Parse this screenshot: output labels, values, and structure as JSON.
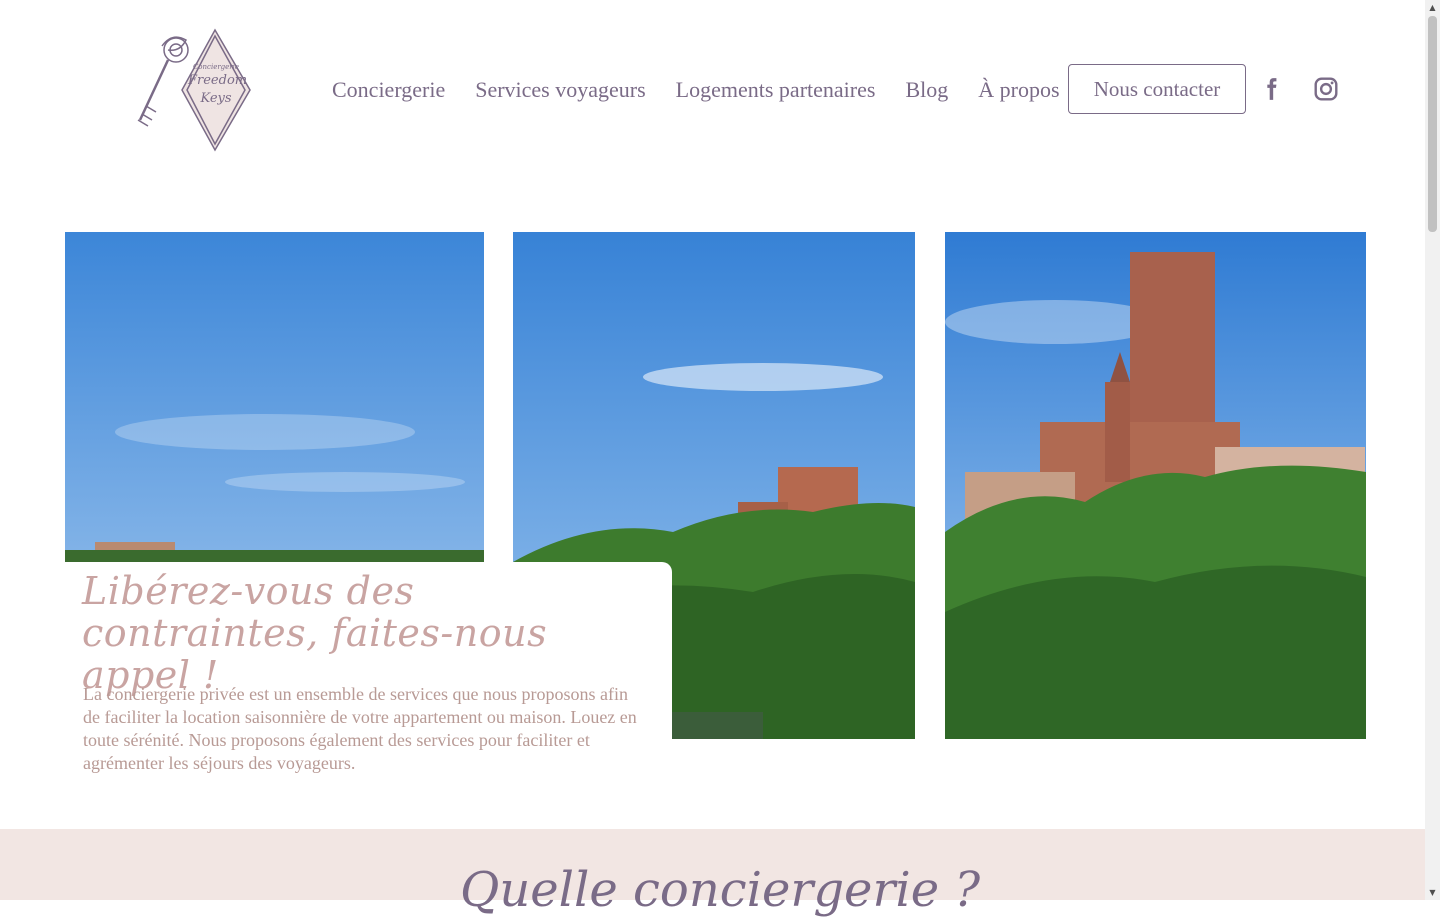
{
  "header": {
    "logo_text_top": "Conciergerie",
    "logo_text_line1": "Freedom",
    "logo_text_line2": "Keys",
    "nav": [
      {
        "label": "Conciergerie"
      },
      {
        "label": "Services voyageurs"
      },
      {
        "label": "Logements partenaires"
      },
      {
        "label": "Blog"
      },
      {
        "label": "À propos"
      }
    ],
    "contact_button": "Nous contacter",
    "social": [
      {
        "icon": "facebook-icon"
      },
      {
        "icon": "instagram-icon"
      }
    ]
  },
  "hero": {
    "title": "Libérez-vous des contraintes, faites-nous appel !",
    "text": "La conciergerie privée est un ensemble de services que nous proposons afin de faciliter la location saisonnière de votre appartement ou maison. Louez en toute sérénité. Nous proposons également des services pour faciliter et agrémenter les séjours des voyageurs."
  },
  "section": {
    "title_partial": "Quelle conciergerie ?"
  },
  "colors": {
    "accent": "#7a6b87",
    "hero_title": "#c9a4a2",
    "hero_text": "#b89a95",
    "band": "#f2e6e3"
  }
}
